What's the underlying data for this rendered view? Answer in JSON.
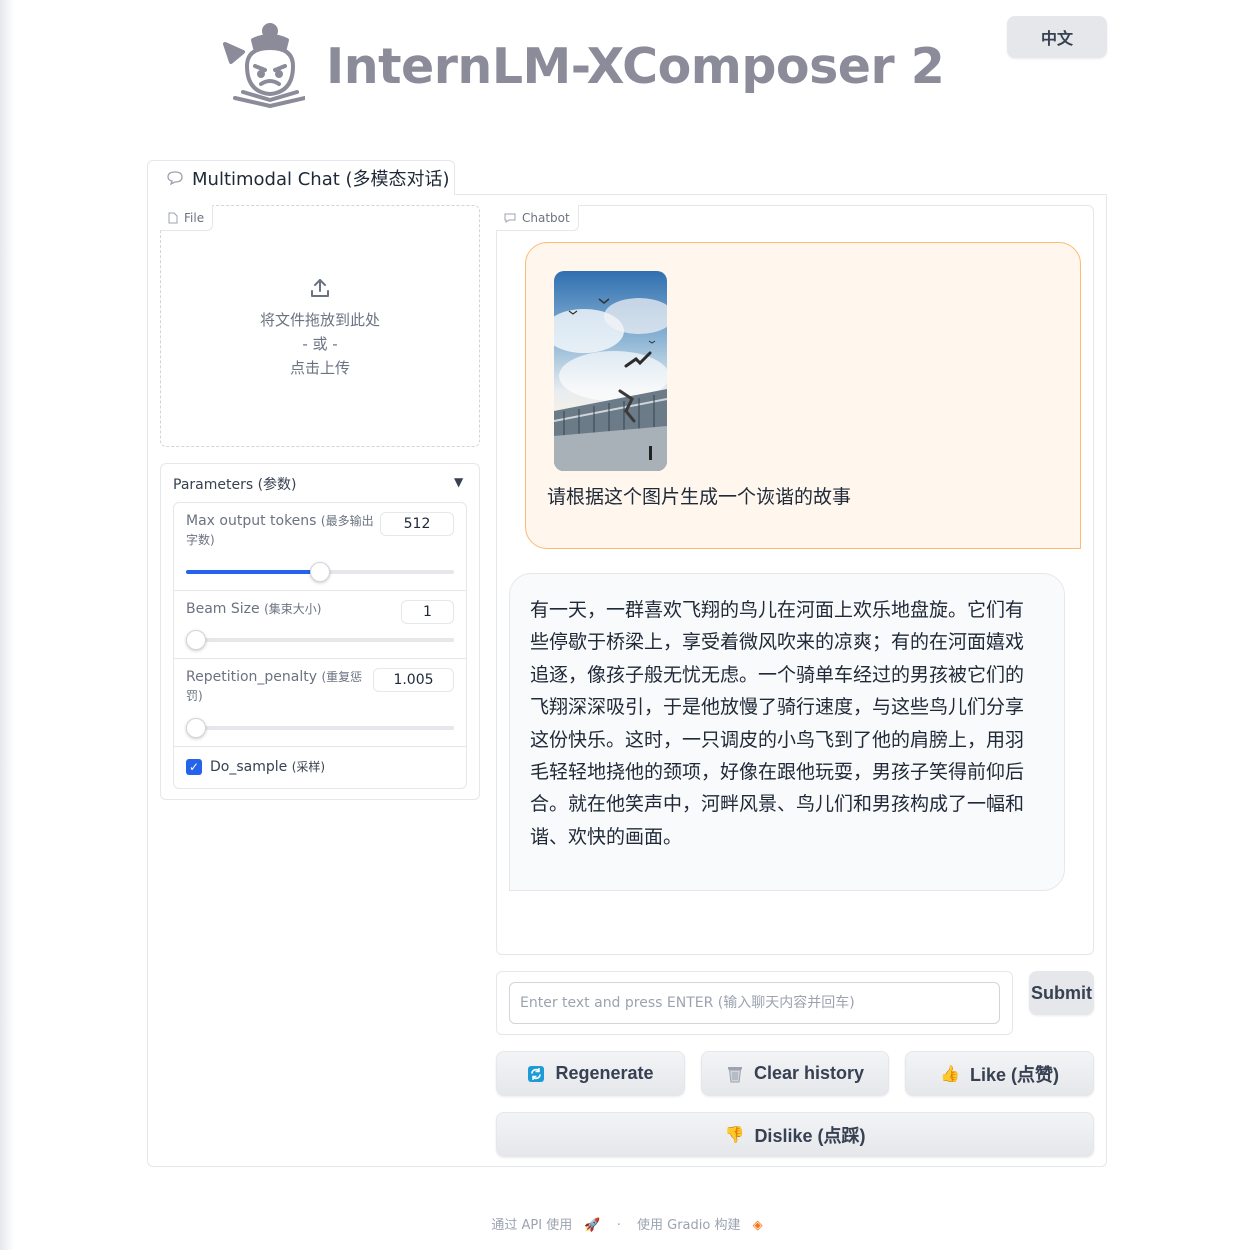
{
  "header": {
    "brand": "InternLM-XComposer 2",
    "language_button": "中文"
  },
  "tabs": [
    {
      "label": "Multimodal Chat (多模态对话)"
    }
  ],
  "file_upload": {
    "chip_label": "File",
    "drop_text": "将文件拖放到此处",
    "or_text": "- 或 -",
    "click_text": "点击上传"
  },
  "parameters": {
    "title": "Parameters (参数)",
    "max_tokens": {
      "label": "Max output tokens",
      "label_cn": "(最多输出字数)",
      "value": "512",
      "fraction": 0.5
    },
    "beam_size": {
      "label": "Beam Size",
      "label_cn": "(集束大小)",
      "value": "1",
      "fraction": 0.0
    },
    "repetition_penalty": {
      "label": "Repetition_penalty",
      "label_cn": "(重复惩罚)",
      "value": "1.005",
      "fraction": 0.0
    },
    "do_sample": {
      "label": "Do_sample",
      "label_cn": "(采样)",
      "checked": true
    }
  },
  "chatbot": {
    "chip_label": "Chatbot",
    "messages": [
      {
        "role": "user",
        "text": "请根据这个图片生成一个诙谐的故事"
      },
      {
        "role": "bot",
        "text": "有一天，一群喜欢飞翔的鸟儿在河面上欢乐地盘旋。它们有些停歇于桥梁上，享受着微风吹来的凉爽；有的在河面嬉戏追逐，像孩子般无忧无虑。一个骑单车经过的男孩被它们的飞翔深深吸引，于是他放慢了骑行速度，与这些鸟儿们分享这份快乐。这时，一只调皮的小鸟飞到了他的肩膀上，用羽毛轻轻地挠他的颈项，好像在跟他玩耍，男孩子笑得前仰后合。就在他笑声中，河畔风景、鸟儿们和男孩构成了一幅和谐、欢快的画面。"
      }
    ]
  },
  "input": {
    "placeholder": "Enter text and press ENTER (输入聊天内容并回车)",
    "value": ""
  },
  "buttons": {
    "submit": "Submit",
    "regenerate": "Regenerate",
    "clear_history": "Clear history",
    "like": "Like (点赞)",
    "dislike": "Dislike (点踩)"
  },
  "footer": {
    "api": "通过 API 使用",
    "separator": "·",
    "built_with": "使用 Gradio 构建"
  },
  "colors": {
    "accent": "#2563eb",
    "user_bubble_bg": "#fff7ed",
    "user_bubble_border": "#fdba74",
    "bot_bubble_bg": "#f9fafb",
    "brand_text": "#8b8b99"
  }
}
